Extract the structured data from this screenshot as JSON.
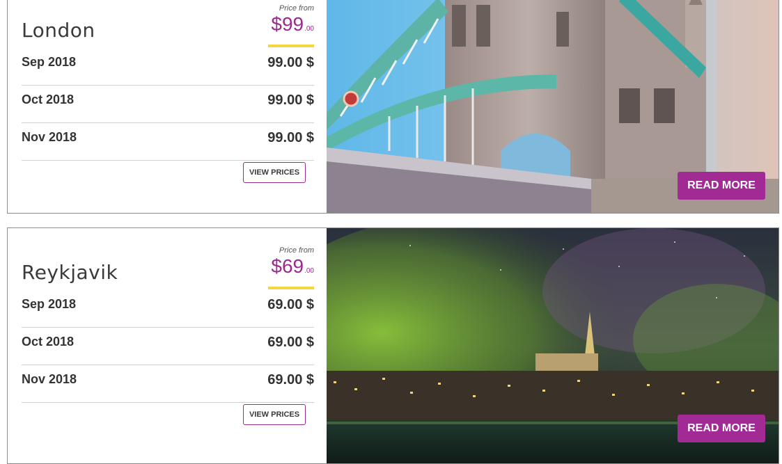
{
  "cards": [
    {
      "city": "London",
      "price_from_label": "Price from",
      "price_symbol": "$",
      "price_main": "99",
      "price_decimals": ".00",
      "months": [
        {
          "month": "Sep 2018",
          "price": "99.00 $"
        },
        {
          "month": "Oct 2018",
          "price": "99.00 $"
        },
        {
          "month": "Nov 2018",
          "price": "99.00 $"
        }
      ],
      "view_prices_label": "VIEW PRICES",
      "read_more_label": "READ MORE",
      "photo_icon": "tower-bridge-photo"
    },
    {
      "city": "Reykjavik",
      "price_from_label": "Price from",
      "price_symbol": "$",
      "price_main": "69",
      "price_decimals": ".00",
      "months": [
        {
          "month": "Sep 2018",
          "price": "69.00 $"
        },
        {
          "month": "Oct 2018",
          "price": "69.00 $"
        },
        {
          "month": "Nov 2018",
          "price": "69.00 $"
        }
      ],
      "view_prices_label": "VIEW PRICES",
      "read_more_label": "READ MORE",
      "photo_icon": "northern-lights-city-photo"
    }
  ],
  "colors": {
    "accent": "#9b2a8e",
    "button_bg": "#a22a95",
    "price_bar": "#f7d63d",
    "border": "#8c8c8c"
  }
}
